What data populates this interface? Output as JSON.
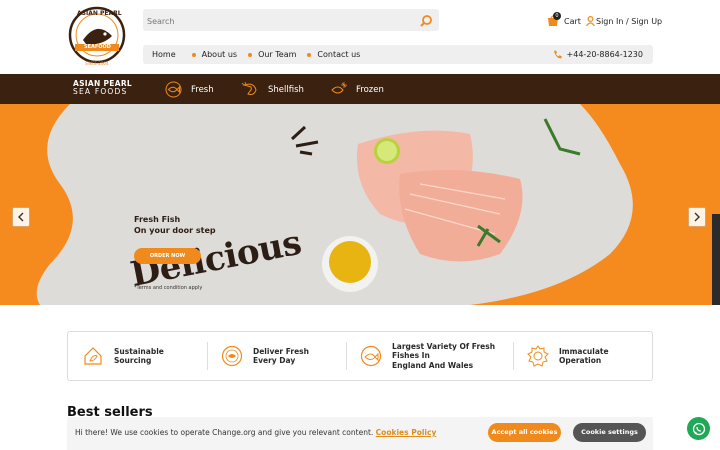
{
  "header": {
    "logo": {
      "line1": "ASIAN PEARL",
      "line2": "SEAFOOD",
      "since": "SINCE 2004"
    },
    "search": {
      "placeholder": "Search"
    },
    "cart": {
      "label": "Cart",
      "count": "0"
    },
    "signin": {
      "label": "Sign In / Sign Up"
    }
  },
  "subnav": {
    "links": [
      "Home",
      "About us",
      "Our Team",
      "Contact us"
    ],
    "phone": "+44-20-8864-1230"
  },
  "catbar": {
    "brand_line1": "ASIAN PEARL",
    "brand_line2": "SEA FOODS",
    "categories": [
      "Fresh",
      "Shellfish",
      "Frozen"
    ]
  },
  "hero": {
    "title": "Delicious",
    "sub1": "Fresh Fish",
    "sub2": "On your door step",
    "cta": "ORDER NOW",
    "terms": "*Terms and condition apply"
  },
  "features": [
    {
      "line1": "Sustainable",
      "line2": "Sourcing",
      "line3": "",
      "icon": "house-leaf-icon"
    },
    {
      "line1": "Deliver Fresh",
      "line2": "Every Day",
      "line3": "",
      "icon": "fresh-badge-icon"
    },
    {
      "line1": "Largest Variety Of Fresh",
      "line2": "Fishes In",
      "line3": "England And Wales",
      "icon": "fish-badge-icon"
    },
    {
      "line1": "Immaculate",
      "line2": "Operation",
      "line3": "",
      "icon": "gear-badge-icon"
    }
  ],
  "best_sellers": {
    "title": "Best sellers"
  },
  "cookie": {
    "message": "Hi there! We use cookies to operate Change.org and give you relevant content.",
    "policy": "Cookies Policy",
    "accept": "Accept all cookies",
    "settings": "Cookie settings"
  },
  "colors": {
    "accent": "#f08a1d",
    "brown": "#3b2210",
    "whatsapp": "#1fa855"
  }
}
